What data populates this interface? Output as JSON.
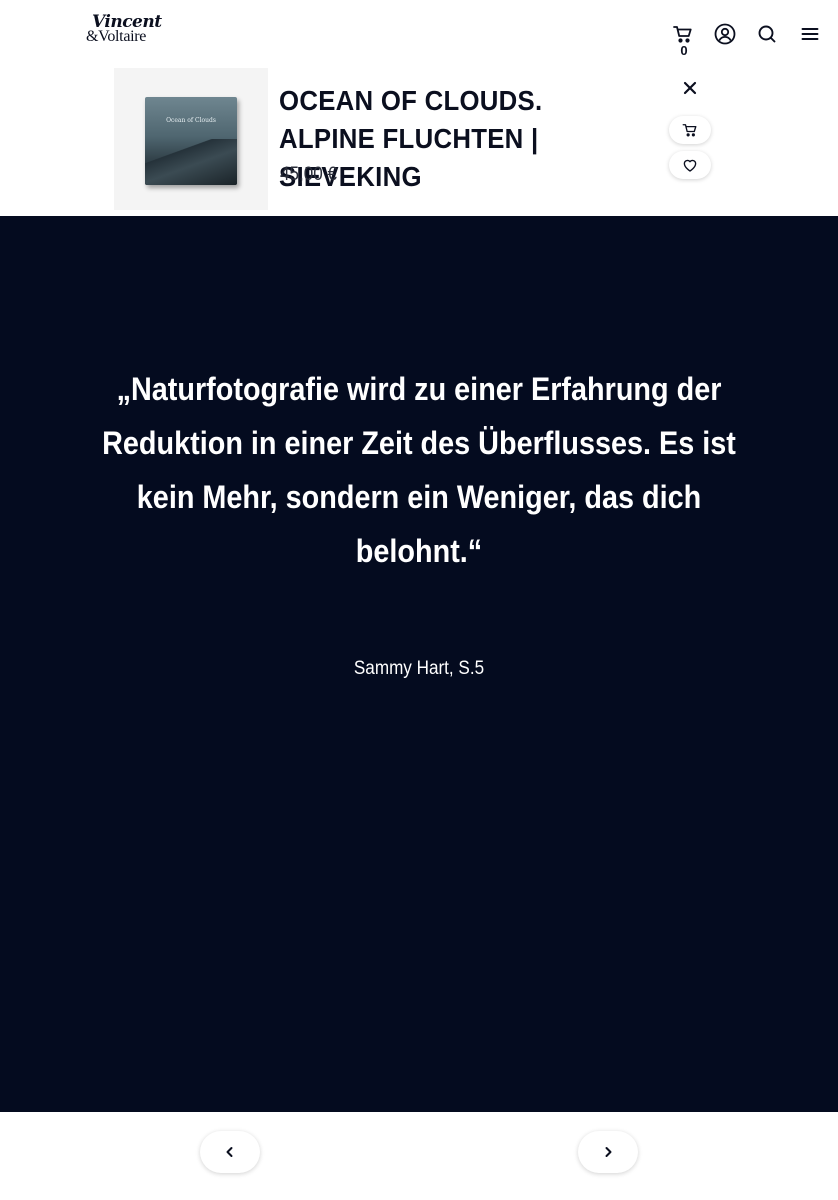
{
  "header": {
    "logo_line1": "Vincent",
    "logo_line2": "&Voltaire",
    "cart_count": "0",
    "icons": [
      "cart-icon",
      "account-icon",
      "search-icon",
      "menu-icon"
    ]
  },
  "product": {
    "title": "OCEAN OF CLOUDS. ALPINE FLUCHTEN | SIEVEKING",
    "price": "45,00 €",
    "cover_text": "Ocean of Clouds",
    "actions": [
      "close-icon",
      "cart-icon",
      "heart-icon"
    ]
  },
  "quote": {
    "text": "„Naturfotografie wird zu einer Erfahrung der Reduktion in einer Zeit des Überflusses. Es ist kein Mehr, sondern ein Weniger, das dich belohnt.“",
    "attribution": "Sammy Hart, S.5",
    "background": "#040b1f"
  },
  "footer": {
    "prev_icon": "chevron-left-icon",
    "next_icon": "chevron-right-icon"
  }
}
